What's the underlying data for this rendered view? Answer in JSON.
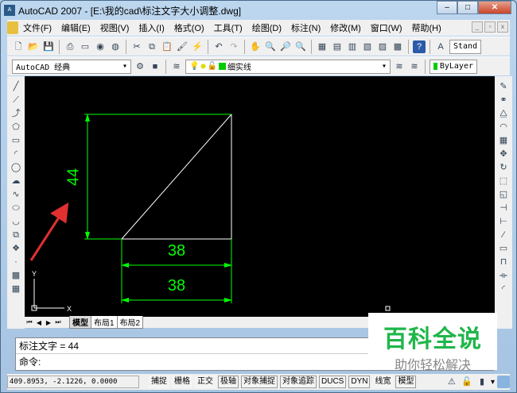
{
  "window": {
    "title": "AutoCAD 2007 - [E:\\我的cad\\标注文字大小调整.dwg]",
    "min": "–",
    "max": "□",
    "close": "✕"
  },
  "menu": [
    "文件(F)",
    "编辑(E)",
    "视图(V)",
    "插入(I)",
    "格式(O)",
    "工具(T)",
    "绘图(D)",
    "标注(N)",
    "修改(M)",
    "窗口(W)",
    "帮助(H)"
  ],
  "toolbar": {
    "text_style": "Stand",
    "workspace": "AutoCAD 经典",
    "layer": "细实线",
    "color": "ByLayer"
  },
  "drawing": {
    "vertical_dim": "44",
    "dim_top": "38",
    "dim_bottom": "38",
    "ucs_y": "Y",
    "ucs_x": "X",
    "line_color": "#ffffff",
    "dim_color": "#00ff00",
    "arrow_color": "#e03030"
  },
  "tabs": [
    "模型",
    "布局1",
    "布局2"
  ],
  "command": {
    "history": "标注文字 = 44",
    "prompt": "命令:"
  },
  "status": {
    "coords": "409.8953, -2.1226, 0.0000",
    "buttons": [
      "捕捉",
      "栅格",
      "正交",
      "极轴",
      "对象捕捉",
      "对象追踪",
      "DUCS",
      "DYN",
      "线宽",
      "模型"
    ]
  },
  "watermark": {
    "title": "百科全说",
    "subtitle": "助你轻松解决"
  }
}
